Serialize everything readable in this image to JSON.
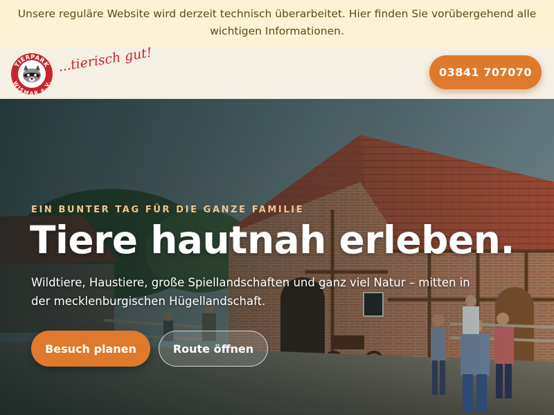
{
  "notice": {
    "line1": "Unsere reguläre Website wird derzeit technisch überarbeitet. Hier finden Sie vorübergehend alle",
    "line2": "wichtigen Informationen."
  },
  "header": {
    "logo": {
      "text_top": "TIERPARK",
      "text_bottom": "WISMAR e.V.",
      "icon": "raccoon-icon"
    },
    "tagline": "...tierisch gut!",
    "phone_label": "03841 707070"
  },
  "hero": {
    "eyebrow": "EIN BUNTER TAG FÜR DIE GANZE FAMILIE",
    "headline": "Tiere hautnah erleben.",
    "lead": "Wildtiere, Haustiere, große Spiellandschaften und ganz viel Natur – mitten in der mecklenburgischen Hügellandschaft.",
    "primary_button": "Besuch planen",
    "secondary_button": "Route öffnen"
  },
  "colors": {
    "notice_bg": "#fdf3d4",
    "header_bg": "#f6efe3",
    "accent": "#df7a2c",
    "eyebrow": "#f3c58d",
    "logo_red": "#c9242b"
  }
}
